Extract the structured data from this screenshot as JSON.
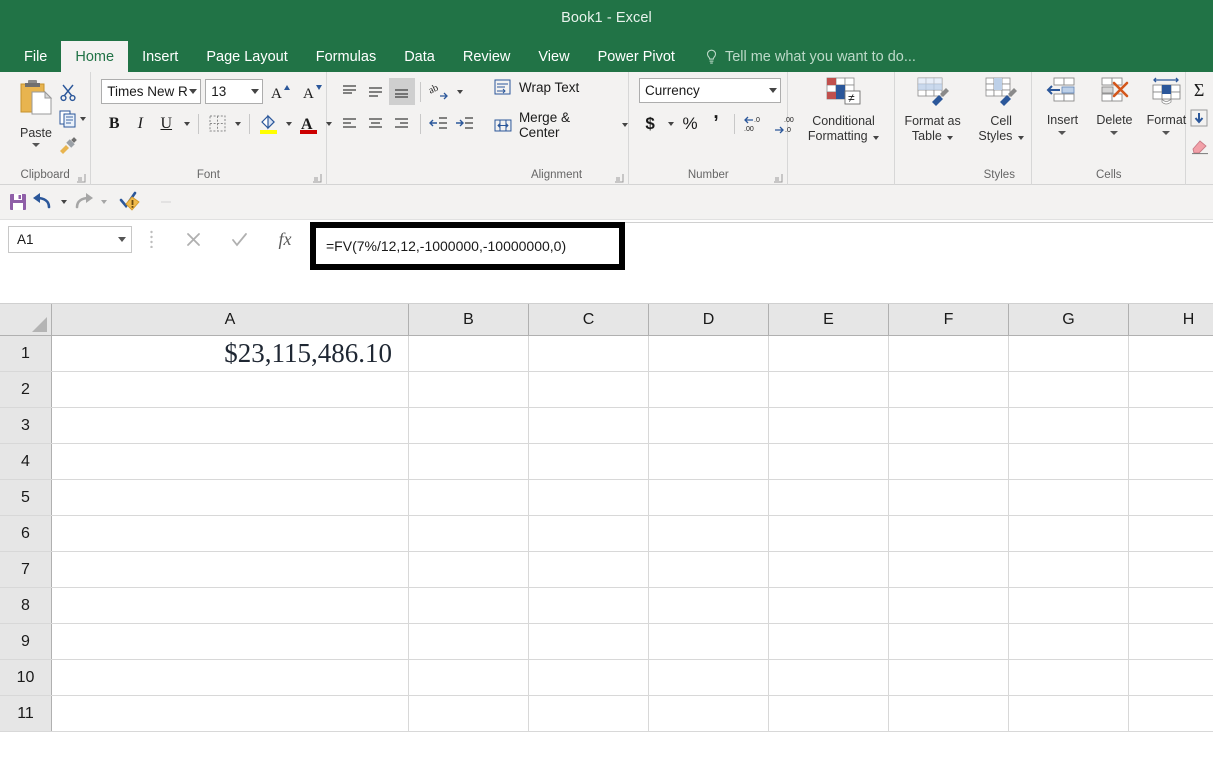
{
  "window": {
    "title": "Book1 - Excel"
  },
  "theme": {
    "green": "#217346",
    "ribbon_bg": "#f3f2f1",
    "accent_blue": "#2b579a"
  },
  "tabs": [
    {
      "label": "File",
      "active": false
    },
    {
      "label": "Home",
      "active": true
    },
    {
      "label": "Insert",
      "active": false
    },
    {
      "label": "Page Layout",
      "active": false
    },
    {
      "label": "Formulas",
      "active": false
    },
    {
      "label": "Data",
      "active": false
    },
    {
      "label": "Review",
      "active": false
    },
    {
      "label": "View",
      "active": false
    },
    {
      "label": "Power Pivot",
      "active": false
    }
  ],
  "tell_me": {
    "placeholder": "Tell me what you want to do...",
    "icon": "lightbulb-icon"
  },
  "ribbon": {
    "clipboard": {
      "label": "Clipboard",
      "paste_label": "Paste",
      "cut_label": "Cut",
      "copy_label": "Copy",
      "format_painter_label": "Format Painter"
    },
    "font": {
      "label": "Font",
      "font_name": "Times New Ro",
      "font_size": "13",
      "grow_label": "A",
      "shrink_label": "A",
      "bold_label": "B",
      "italic_label": "I",
      "underline_label": "U"
    },
    "alignment": {
      "label": "Alignment",
      "wrap_text_label": "Wrap Text",
      "merge_center_label": "Merge & Center"
    },
    "number": {
      "label": "Number",
      "format": "Currency",
      "accounting_label": "$",
      "percent_label": "%",
      "comma_label": ","
    },
    "styles": {
      "label": "Styles",
      "conditional_formatting_label": "Conditional\nFormatting",
      "conditional_formatting_line1": "Conditional",
      "conditional_formatting_line2": "Formatting",
      "format_as_table_line1": "Format as",
      "format_as_table_line2": "Table",
      "cell_styles_line1": "Cell",
      "cell_styles_line2": "Styles"
    },
    "cells": {
      "label": "Cells",
      "insert_label": "Insert",
      "delete_label": "Delete",
      "format_label": "Format"
    },
    "editing": {
      "autosum_label": "Σ",
      "fill_label": "fill-icon",
      "clear_label": "clear-icon"
    }
  },
  "quick_access": {
    "save_label": "save-icon",
    "undo_label": "undo-icon",
    "redo_label": "redo-icon",
    "check_label": "spelling-check-icon"
  },
  "formula_bar": {
    "name_box_value": "A1",
    "cancel_label": "cancel-icon",
    "enter_label": "enter-icon",
    "fx_label": "fx",
    "formula": "=FV(7%/12,12,-1000000,-10000000,0)"
  },
  "grid": {
    "columns": [
      "A",
      "B",
      "C",
      "D",
      "E",
      "F",
      "G",
      "H"
    ],
    "rows": [
      "1",
      "2",
      "3",
      "4",
      "5",
      "6",
      "7",
      "8",
      "9",
      "10",
      "11"
    ],
    "cells": {
      "A1": "$23,115,486.10"
    }
  }
}
